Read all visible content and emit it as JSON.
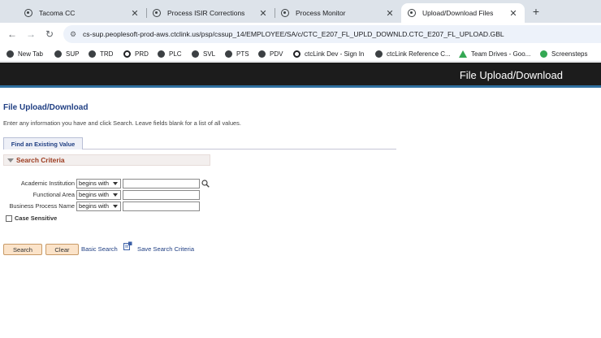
{
  "browser": {
    "tabs": [
      {
        "title": "Tacoma CC"
      },
      {
        "title": "Process ISIR Corrections"
      },
      {
        "title": "Process Monitor"
      },
      {
        "title": "Upload/Download Files"
      }
    ],
    "new_tab_symbol": "+",
    "url": "cs-sup.peoplesoft-prod-aws.ctclink.us/psp/cssup_14/EMPLOYEE/SA/c/CTC_E207_FL_UPLD_DOWNLD.CTC_E207_FL_UPLOAD.GBL",
    "bookmarks": [
      {
        "label": "New Tab"
      },
      {
        "label": "SUP"
      },
      {
        "label": "TRD"
      },
      {
        "label": "PRD"
      },
      {
        "label": "PLC"
      },
      {
        "label": "SVL"
      },
      {
        "label": "PTS"
      },
      {
        "label": "PDV"
      },
      {
        "label": "ctcLink Dev - Sign In"
      },
      {
        "label": "ctcLink Reference C..."
      },
      {
        "label": "Team Drives - Goo..."
      },
      {
        "label": "Screensteps"
      }
    ]
  },
  "banner": {
    "title": "File Upload/Download"
  },
  "page": {
    "title": "File Upload/Download",
    "instructions": "Enter any information you have and click Search. Leave fields blank for a list of all values.",
    "tab_find": "Find an Existing Value",
    "search_criteria": "Search Criteria",
    "fields": [
      {
        "label": "Academic Institution",
        "operator": "begins with",
        "value": ""
      },
      {
        "label": "Functional Area",
        "operator": "begins with",
        "value": ""
      },
      {
        "label": "Business Process Name",
        "operator": "begins with",
        "value": ""
      }
    ],
    "case_sensitive": "Case Sensitive",
    "buttons": {
      "search": "Search",
      "clear": "Clear"
    },
    "links": {
      "basic_search": "Basic Search",
      "save_search": "Save Search Criteria"
    }
  },
  "colors": {
    "banner_bg": "#1c1c1c",
    "link": "#203f83",
    "criteria_header": "#9c3b1f",
    "button_bg": "#fbe3c9"
  }
}
